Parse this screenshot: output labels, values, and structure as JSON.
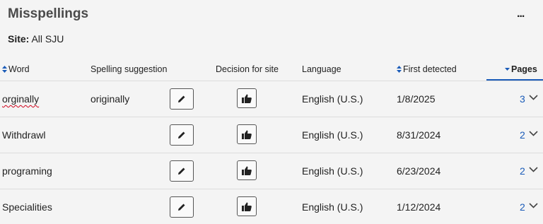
{
  "header": {
    "title": "Misspellings",
    "more_label": "...",
    "site_label": "Site:",
    "site_value": "All SJU"
  },
  "columns": {
    "word": "Word",
    "suggestion": "Spelling suggestion",
    "decision": "Decision for site",
    "language": "Language",
    "first_detected": "First detected",
    "pages": "Pages"
  },
  "rows": [
    {
      "word": "orginally",
      "suggestion": "originally",
      "language": "English (U.S.)",
      "first_detected": "1/8/2025",
      "pages": "3"
    },
    {
      "word": "Withdrawl",
      "suggestion": "",
      "language": "English (U.S.)",
      "first_detected": "8/31/2024",
      "pages": "2"
    },
    {
      "word": "programing",
      "suggestion": "",
      "language": "English (U.S.)",
      "first_detected": "6/23/2024",
      "pages": "2"
    },
    {
      "word": "Specialities",
      "suggestion": "",
      "language": "English (U.S.)",
      "first_detected": "1/12/2024",
      "pages": "2"
    }
  ],
  "icons": {
    "edit": "pencil-icon",
    "decision": "thumbs-up-icon",
    "expand": "chevron-down-icon",
    "sort": "sort-arrows-icon"
  },
  "colors": {
    "link": "#1a5bb8",
    "misspell_underline": "#d0021b"
  }
}
